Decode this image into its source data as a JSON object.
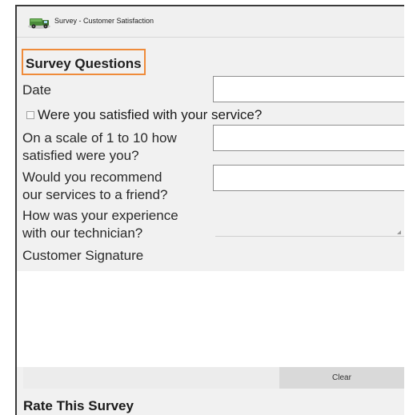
{
  "window": {
    "title": "Survey - Customer Satisfaction",
    "icon": "truck-icon"
  },
  "form": {
    "section_title": "Survey Questions",
    "date_label": "Date",
    "date_value": "",
    "satisfied_checkbox_label": "Were you satisfied with your service?",
    "satisfied_checked": false,
    "scale_label_line1": "On a scale of 1 to 10 how",
    "scale_label_line2": "satisfied were you?",
    "scale_value": "",
    "recommend_label_line1": "Would you recommend",
    "recommend_label_line2": "our services to a friend?",
    "recommend_value": "",
    "technician_label_line1": "How was your experience",
    "technician_label_line2": "with our technician?",
    "technician_value": "",
    "signature_label": "Customer Signature",
    "clear_button": "Clear",
    "rate_section_title": "Rate This Survey"
  },
  "colors": {
    "highlight_border": "#ef8b3a",
    "frame_background": "#f1f1f1",
    "input_background": "#ffffff"
  }
}
